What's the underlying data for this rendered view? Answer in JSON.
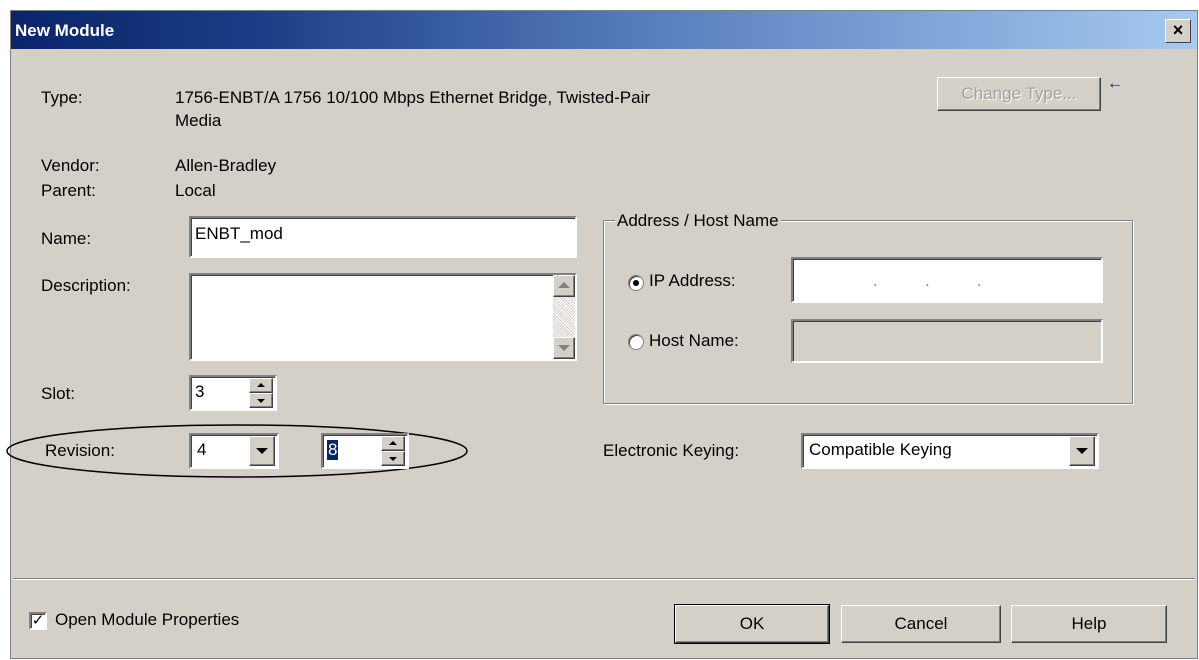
{
  "window": {
    "title": "New Module",
    "close_glyph": "×"
  },
  "fields": {
    "type_label": "Type:",
    "type_value_line1": "1756-ENBT/A 1756 10/100 Mbps Ethernet Bridge, Twisted-Pair",
    "type_value_line2": "Media",
    "vendor_label": "Vendor:",
    "vendor_value": "Allen-Bradley",
    "parent_label": "Parent:",
    "parent_value": "Local",
    "name_label": "Name:",
    "name_value": "ENBT_mod",
    "description_label": "Description:",
    "description_value": "",
    "slot_label": "Slot:",
    "slot_value": "3",
    "revision_label": "Revision:",
    "revision_major": "4",
    "revision_minor": "8"
  },
  "change_type_button": "Change Type...",
  "change_type_arrow": "←",
  "address_group": {
    "title": "Address / Host Name",
    "ip_label": "IP Address:",
    "ip_value": ".          .          .",
    "ip_selected": true,
    "host_label": "Host Name:",
    "host_value": ""
  },
  "keying": {
    "label": "Electronic Keying:",
    "value": "Compatible Keying"
  },
  "open_properties": {
    "label": "Open Module Properties",
    "checked": true,
    "check_glyph": "✓"
  },
  "buttons": {
    "ok": "OK",
    "cancel": "Cancel",
    "help": "Help"
  }
}
